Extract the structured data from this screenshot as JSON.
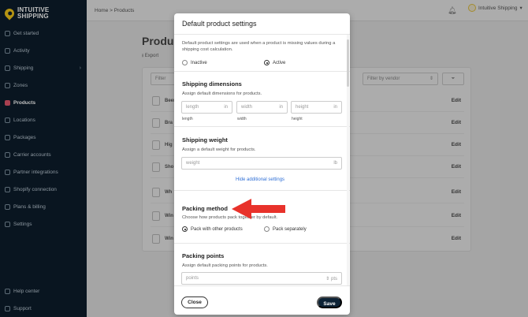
{
  "logo": {
    "line1": "INTUITIVE",
    "line2": "SHIPPING"
  },
  "sidebar": {
    "items": [
      {
        "label": "Get started",
        "icon": "rocket-icon"
      },
      {
        "label": "Activity",
        "icon": "activity-icon"
      },
      {
        "label": "Shipping",
        "icon": "truck-icon"
      },
      {
        "label": "Zones",
        "icon": "globe-icon"
      },
      {
        "label": "Products",
        "icon": "shirt-icon"
      },
      {
        "label": "Locations",
        "icon": "pin-icon"
      },
      {
        "label": "Packages",
        "icon": "box-icon"
      },
      {
        "label": "Carrier accounts",
        "icon": "carrier-icon"
      },
      {
        "label": "Partner integrations",
        "icon": "puzzle-icon"
      },
      {
        "label": "Shopify connection",
        "icon": "link-icon"
      },
      {
        "label": "Plans & billing",
        "icon": "card-icon"
      },
      {
        "label": "Settings",
        "icon": "gear-icon"
      }
    ],
    "bottom": [
      {
        "label": "Help center",
        "icon": "help-icon"
      },
      {
        "label": "Support",
        "icon": "support-icon"
      }
    ],
    "active_index": 4,
    "active_color": "#e0566b"
  },
  "topbar": {
    "breadcrumb": "Home > Products",
    "user_name": "Intuitive Shipping"
  },
  "background_page": {
    "title": "Produc",
    "export_label": "Export",
    "export_prefix": "⭳",
    "filter_partial": "Filter",
    "filter_vendor_placeholder": "Filter by vendor",
    "rows": [
      {
        "name": "Beer",
        "edit": "Edit"
      },
      {
        "name": "Bra",
        "edit": "Edit"
      },
      {
        "name": "Hig",
        "edit": "Edit"
      },
      {
        "name": "Sho",
        "edit": "Edit"
      },
      {
        "name": "Wh",
        "edit": "Edit"
      },
      {
        "name": "Win",
        "edit": "Edit"
      },
      {
        "name": "Win",
        "edit": "Edit"
      }
    ]
  },
  "modal": {
    "title": "Default product settings",
    "intro": "Default product settings are used when a product is missing values during a shipping cost calculation.",
    "status": {
      "inactive_label": "Inactive",
      "active_label": "Active",
      "selected": "Active"
    },
    "dimensions": {
      "title": "Shipping dimensions",
      "desc": "Assign default dimensions for products.",
      "length": {
        "placeholder": "length",
        "unit": "in",
        "label": "length"
      },
      "width": {
        "placeholder": "width",
        "unit": "in",
        "label": "width"
      },
      "height": {
        "placeholder": "height",
        "unit": "in",
        "label": "height"
      }
    },
    "weight": {
      "title": "Shipping weight",
      "desc": "Assign a default weight for products.",
      "placeholder": "weight",
      "unit": "lb"
    },
    "hide_link": "Hide additional settings",
    "packing": {
      "title": "Packing method",
      "desc": "Choose how products pack together by default.",
      "option_with": "Pack with other products",
      "option_separate": "Pack separately",
      "selected": "Pack with other products"
    },
    "points": {
      "title": "Packing points",
      "desc": "Assign default packing points for products.",
      "placeholder": "points",
      "unit": "pts"
    },
    "close_label": "Close",
    "save_label": "Save"
  },
  "annotation_color": "#e8322b"
}
